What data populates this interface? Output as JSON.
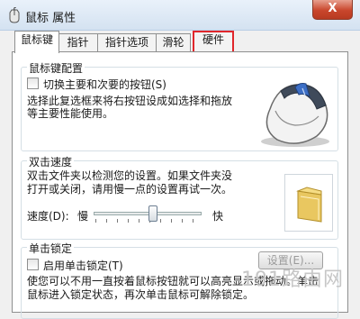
{
  "window": {
    "title": "鼠标 属性",
    "close_label": "X"
  },
  "tabs": [
    {
      "label": "鼠标键"
    },
    {
      "label": "指针"
    },
    {
      "label": "指针选项"
    },
    {
      "label": "滑轮"
    },
    {
      "label": "硬件"
    }
  ],
  "button_config": {
    "title": "鼠标键配置",
    "switch_label": "切换主要和次要的按钮(S)",
    "switch_checked": false,
    "description_line1": "选择此复选框来将右按钮设成如选择和拖放",
    "description_line2": "等主要性能使用。"
  },
  "double_click": {
    "title": "双击速度",
    "description_line1": "双击文件夹以检测您的设置。如果文件夹没",
    "description_line2": "打开或关闭，请用慢一点的设置再试一次。",
    "speed_label": "速度(D):",
    "slow_label": "慢",
    "fast_label": "快",
    "speed_value": 0.55
  },
  "click_lock": {
    "title": "单击锁定",
    "enable_label": "启用单击锁定(T)",
    "enable_checked": false,
    "settings_label": "设置(E)...",
    "description_line1": "使您可以不用一直按着鼠标按钮就可以高亮显示或拖动。单击",
    "description_line2": "鼠标进入锁定状态，再次单击鼠标可解除锁定。"
  },
  "watermark": "191路由网"
}
